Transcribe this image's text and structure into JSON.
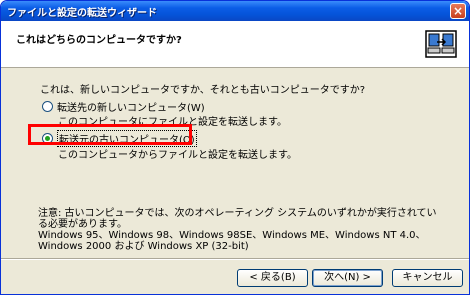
{
  "window": {
    "title": "ファイルと設定の転送ウィザード",
    "close_symbol": "×"
  },
  "header": {
    "title": "これはどちらのコンピュータですか?",
    "icon": "wizard-transfer-icon"
  },
  "main": {
    "question": "これは、新しいコンピュータですか、それとも古いコンピュータですか?",
    "options": [
      {
        "label": "転送先の新しいコンピュータ(W)",
        "description": "このコンピュータにファイルと設定を転送します。",
        "selected": false
      },
      {
        "label": "転送元の古いコンピュータ(O)",
        "description": "このコンピュータからファイルと設定を転送します。",
        "selected": true
      }
    ],
    "note": "注意: 古いコンピュータでは、次のオペレーティング システムのいずれかが実行されている必要があります。",
    "os_list": "Windows 95、Windows 98、Windows 98SE、Windows ME、Windows NT 4.0、Windows 2000 および Windows XP (32-bit)"
  },
  "buttons": {
    "back": "< 戻る(B)",
    "next": "次へ(N) >",
    "cancel": "キャンセル"
  },
  "colors": {
    "highlight": "#ff0000",
    "title_bar": "#0553d8"
  }
}
